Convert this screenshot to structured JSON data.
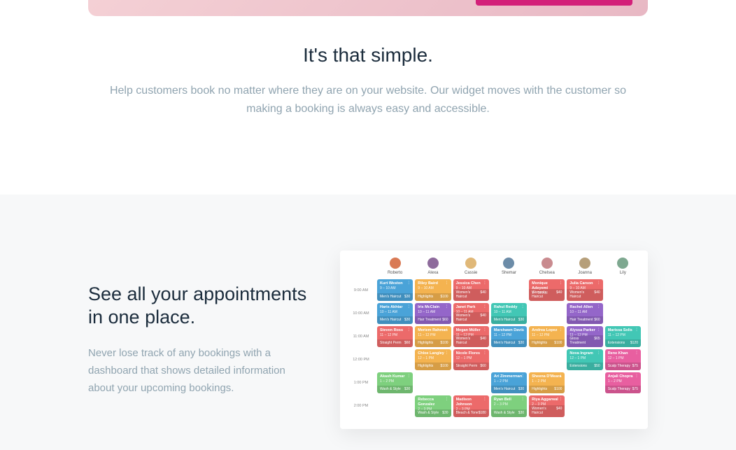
{
  "section1": {
    "heading": "It's that simple.",
    "body": "Help customers book no matter where they are on your website. Our widget moves with the customer so making a booking is always easy and accessible."
  },
  "section2": {
    "heading": "See all your appointments in one place.",
    "body": "Never lose track of any bookings with a dashboard that shows detailed information about your upcoming bookings."
  },
  "calendar": {
    "staff": [
      {
        "name": "Roberto",
        "color": "#d97a55"
      },
      {
        "name": "Alexa",
        "color": "#8e6b9c"
      },
      {
        "name": "Cassie",
        "color": "#e0b878"
      },
      {
        "name": "Shemar",
        "color": "#6c8ca8"
      },
      {
        "name": "Chelsea",
        "color": "#c98b8f"
      },
      {
        "name": "Joanna",
        "color": "#b69f7a"
      },
      {
        "name": "Lily",
        "color": "#7ea890"
      }
    ],
    "times": [
      "9:00 AM",
      "10:00 AM",
      "11:00 AM",
      "12:00 PM",
      "1:00 PM",
      "2:00 PM"
    ],
    "rows": [
      [
        {
          "name": "Kurt Weston",
          "time": "9 – 10 AM",
          "svc": "Men's Haircut",
          "price": "$30",
          "color": "#4aa3d8"
        },
        {
          "name": "Riley Baird",
          "time": "9 – 10 AM",
          "svc": "Highlights",
          "price": "$100",
          "color": "#f4b350"
        },
        {
          "name": "Jessica Chen",
          "time": "9 – 10 AM",
          "svc": "Women's Haircut",
          "price": "$40",
          "color": "#ec6a6a"
        },
        null,
        {
          "name": "Monique Adeyemi",
          "time": "9 – 10 AM",
          "svc": "Women's Haircut",
          "price": "$40",
          "color": "#ec6a6a"
        },
        {
          "name": "Julia Carson",
          "time": "9 – 10 AM",
          "svc": "Women's Haircut",
          "price": "$40",
          "color": "#ec6a6a"
        },
        null
      ],
      [
        {
          "name": "Haris Akhtar",
          "time": "10 – 11 AM",
          "svc": "Men's Haircut",
          "price": "$30",
          "color": "#4aa3d8"
        },
        {
          "name": "Iris McClain",
          "time": "10 – 11 AM",
          "svc": "Hair Treatment",
          "price": "$60",
          "color": "#9466c9"
        },
        {
          "name": "Janet Park",
          "time": "10 – 11 AM",
          "svc": "Women's Haircut",
          "price": "$40",
          "color": "#ec6a6a"
        },
        {
          "name": "Rahul Reddy",
          "time": "10 – 11 AM",
          "svc": "Men's Haircut",
          "price": "$30",
          "color": "#42c7b5"
        },
        null,
        {
          "name": "Rachel Allen",
          "time": "10 – 11 AM",
          "svc": "Hair Treatment",
          "price": "$60",
          "color": "#9466c9"
        },
        null
      ],
      [
        {
          "name": "Steven Ross",
          "time": "11 – 12 PM",
          "svc": "Straight Perm",
          "price": "$60",
          "color": "#ec6a6a"
        },
        {
          "name": "Meriem Rahman",
          "time": "11 – 12 PM",
          "svc": "Highlights",
          "price": "$100",
          "color": "#f4b350"
        },
        {
          "name": "Megan Müller",
          "time": "11 – 12 PM",
          "svc": "Women's Haircut",
          "price": "$40",
          "color": "#ec6a6a"
        },
        {
          "name": "Marshawn Davis",
          "time": "11 – 12 PM",
          "svc": "Men's Haircut",
          "price": "$30",
          "color": "#4aa3d8"
        },
        {
          "name": "Andrea Lopez",
          "time": "11 – 12 PM",
          "svc": "Highlights",
          "price": "$100",
          "color": "#f4b350"
        },
        {
          "name": "Alyssa Parker",
          "time": "11 – 12 PM",
          "svc": "Gloss Treatment",
          "price": "$65",
          "color": "#9466c9"
        },
        {
          "name": "Marissa Solis",
          "time": "11 – 12 PM",
          "svc": "Extensions",
          "price": "$120",
          "color": "#42c7b5"
        }
      ],
      [
        null,
        {
          "name": "Chloe Langley",
          "time": "12 – 1 PM",
          "svc": "Highlights",
          "price": "$100",
          "color": "#f4b350"
        },
        {
          "name": "Nicole Flores",
          "time": "12 – 1 PM",
          "svc": "Straight Perm",
          "price": "$60",
          "color": "#ec6a6a"
        },
        null,
        null,
        {
          "name": "Nova Ingram",
          "time": "12 – 1 PM",
          "svc": "Extensions",
          "price": "$50",
          "color": "#42c7b5"
        },
        {
          "name": "Rene Khan",
          "time": "12 – 1 PM",
          "svc": "Scalp Therapy",
          "price": "$75",
          "color": "#e85fa0"
        }
      ],
      [
        {
          "name": "Akash Kumar",
          "time": "1 – 2 PM",
          "svc": "Wash & Style",
          "price": "$30",
          "color": "#7ed07e"
        },
        null,
        null,
        {
          "name": "Ari Zimmerman",
          "time": "1 – 2 PM",
          "svc": "Men's Haircut",
          "price": "$30",
          "color": "#4aa3d8"
        },
        {
          "name": "Sheena D'Meara",
          "time": "1 – 2 PM",
          "svc": "Highlights",
          "price": "$100",
          "color": "#f4b350"
        },
        null,
        {
          "name": "Anjali Chopra",
          "time": "1 – 2 PM",
          "svc": "Scalp Therapy",
          "price": "$75",
          "color": "#e85fa0"
        }
      ],
      [
        null,
        {
          "name": "Rebecca Gonzalez",
          "time": "2 – 3 PM",
          "svc": "Wash & Style",
          "price": "$30",
          "color": "#7ed07e"
        },
        {
          "name": "Madison Johnson",
          "time": "2 – 3 PM",
          "svc": "Bleach & Tone",
          "price": "$180",
          "color": "#ec6a6a"
        },
        {
          "name": "Ryan Bell",
          "time": "2 – 3 PM",
          "svc": "Wash & Style",
          "price": "$30",
          "color": "#7ed07e"
        },
        {
          "name": "Riya Aggarwal",
          "time": "2 – 3 PM",
          "svc": "Women's Haircut",
          "price": "$40",
          "color": "#ec6a6a"
        },
        null,
        null
      ]
    ]
  }
}
